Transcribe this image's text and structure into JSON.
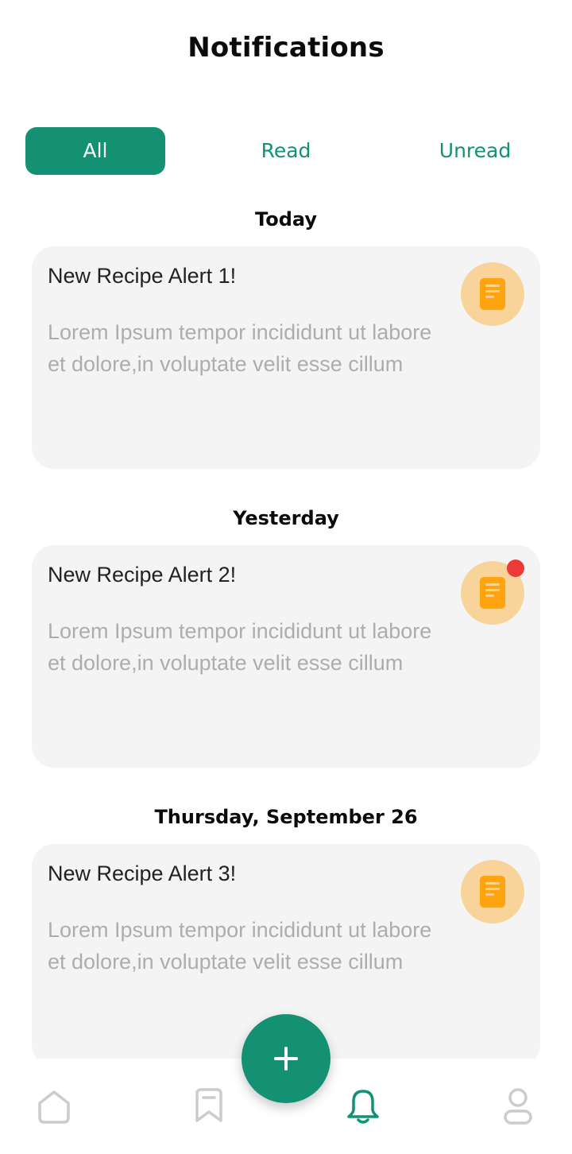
{
  "header": {
    "title": "Notifications"
  },
  "tabs": [
    {
      "label": "All",
      "active": true
    },
    {
      "label": "Read",
      "active": false
    },
    {
      "label": "Unread",
      "active": false
    }
  ],
  "sections": [
    {
      "heading": "Today",
      "notification": {
        "title": "New Recipe Alert 1!",
        "body": "Lorem Ipsum tempor incididunt ut labore et dolore,in voluptate velit esse cillum",
        "icon": "recipe-book-icon",
        "unread": false
      }
    },
    {
      "heading": "Yesterday",
      "notification": {
        "title": "New Recipe Alert 2!",
        "body": "Lorem Ipsum tempor incididunt ut labore et dolore,in voluptate velit esse cillum",
        "icon": "recipe-book-icon",
        "unread": true
      }
    },
    {
      "heading": "Thursday, September 26",
      "notification": {
        "title": "New Recipe Alert 3!",
        "body": "Lorem Ipsum tempor incididunt ut labore et dolore,in voluptate velit esse cillum",
        "icon": "recipe-book-icon",
        "unread": false
      }
    }
  ],
  "bottom_nav": {
    "items": [
      {
        "icon": "home-icon",
        "active": false
      },
      {
        "icon": "bookmark-icon",
        "active": false
      },
      {
        "icon": "bell-icon",
        "active": true
      },
      {
        "icon": "profile-icon",
        "active": false
      }
    ],
    "fab_icon": "plus-icon"
  },
  "colors": {
    "accent": "#149173",
    "card_background": "#f4f4f4",
    "icon_circle": "#f9d49a",
    "icon_fill": "#ffa30f",
    "unread_dot": "#ee3a36",
    "inactive_nav": "#cccccc"
  }
}
